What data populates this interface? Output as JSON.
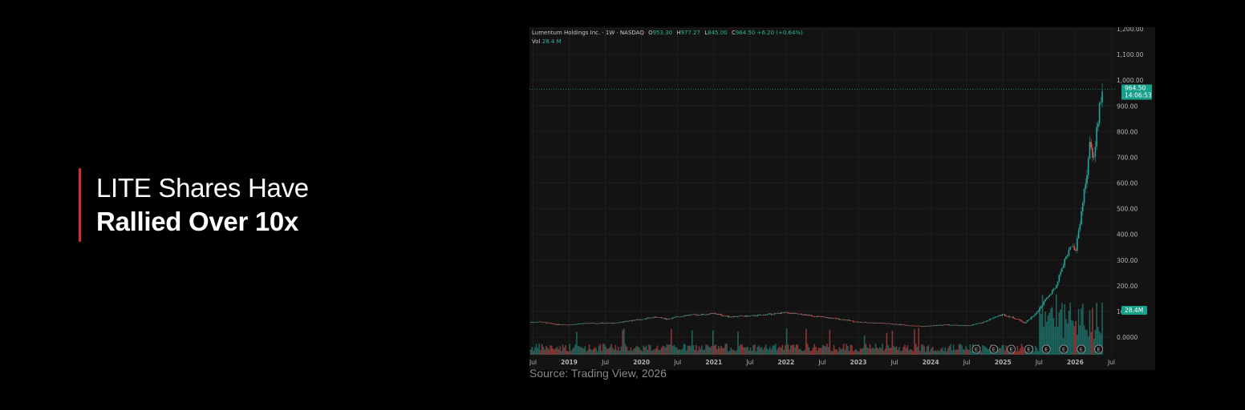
{
  "headline": {
    "line1": "LITE Shares Have",
    "line2": "Rallied Over 10x",
    "accent_color": "#d32f2f"
  },
  "source": "Source: Trading View, 2026",
  "chart_data": {
    "type": "candlestick",
    "symbol_line": "Lumentum Holdings Inc. · 1W · NASDAQ",
    "ohlc": {
      "open_label": "O",
      "open": "953.30",
      "high_label": "H",
      "high": "977.27",
      "low_label": "L",
      "low": "845.00",
      "close_label": "C",
      "close": "964.50",
      "change": "+6.20 (+0.64%)"
    },
    "volume_label": "Vol",
    "volume_value": "28.4 M",
    "last_price_tag": "964.50",
    "countdown_tag": "14:06:53",
    "volume_tag": "28.4M",
    "y_ticks": [
      "1,200.00",
      "1,100.00",
      "1,000.00",
      "900.00",
      "800.00",
      "700.00",
      "600.00",
      "500.00",
      "400.00",
      "300.00",
      "200.00",
      "100.00",
      "0.0000"
    ],
    "y_tick_values": [
      1200,
      1100,
      1000,
      900,
      800,
      700,
      600,
      500,
      400,
      300,
      200,
      100,
      0
    ],
    "ylim": [
      0,
      1200
    ],
    "x_ticks": [
      "Jul",
      "2019",
      "Jul",
      "2020",
      "Jul",
      "2021",
      "Jul",
      "2022",
      "Jul",
      "2023",
      "Jul",
      "2024",
      "Jul",
      "2025",
      "Jul",
      "2026",
      "Jul"
    ],
    "x_tick_years": [
      2018.5,
      2019,
      2019.5,
      2020,
      2020.5,
      2021,
      2021.5,
      2022,
      2022.5,
      2023,
      2023.5,
      2024,
      2024.5,
      2025,
      2025.5,
      2026,
      2026.5
    ],
    "xlim": [
      2018.45,
      2026.55
    ],
    "price_path": [
      {
        "t": 2018.45,
        "p": 58
      },
      {
        "t": 2018.6,
        "p": 60
      },
      {
        "t": 2018.8,
        "p": 50
      },
      {
        "t": 2019.0,
        "p": 48
      },
      {
        "t": 2019.3,
        "p": 55
      },
      {
        "t": 2019.6,
        "p": 54
      },
      {
        "t": 2019.9,
        "p": 66
      },
      {
        "t": 2020.2,
        "p": 78
      },
      {
        "t": 2020.35,
        "p": 70
      },
      {
        "t": 2020.6,
        "p": 85
      },
      {
        "t": 2020.85,
        "p": 88
      },
      {
        "t": 2021.0,
        "p": 92
      },
      {
        "t": 2021.2,
        "p": 80
      },
      {
        "t": 2021.5,
        "p": 82
      },
      {
        "t": 2021.8,
        "p": 90
      },
      {
        "t": 2022.0,
        "p": 95
      },
      {
        "t": 2022.3,
        "p": 85
      },
      {
        "t": 2022.5,
        "p": 78
      },
      {
        "t": 2022.8,
        "p": 68
      },
      {
        "t": 2023.0,
        "p": 58
      },
      {
        "t": 2023.3,
        "p": 55
      },
      {
        "t": 2023.6,
        "p": 48
      },
      {
        "t": 2023.9,
        "p": 42
      },
      {
        "t": 2024.2,
        "p": 48
      },
      {
        "t": 2024.5,
        "p": 44
      },
      {
        "t": 2024.7,
        "p": 55
      },
      {
        "t": 2024.9,
        "p": 80
      },
      {
        "t": 2025.0,
        "p": 88
      },
      {
        "t": 2025.2,
        "p": 70
      },
      {
        "t": 2025.3,
        "p": 55
      },
      {
        "t": 2025.45,
        "p": 90
      },
      {
        "t": 2025.6,
        "p": 150
      },
      {
        "t": 2025.72,
        "p": 190
      },
      {
        "t": 2025.85,
        "p": 300
      },
      {
        "t": 2025.95,
        "p": 360
      },
      {
        "t": 2026.0,
        "p": 330
      },
      {
        "t": 2026.08,
        "p": 480
      },
      {
        "t": 2026.15,
        "p": 620
      },
      {
        "t": 2026.2,
        "p": 740
      },
      {
        "t": 2026.26,
        "p": 700
      },
      {
        "t": 2026.3,
        "p": 820
      },
      {
        "t": 2026.35,
        "p": 930
      },
      {
        "t": 2026.38,
        "p": 964.5
      }
    ],
    "earnings_marker": "E",
    "earnings_markers_count": 8,
    "colors": {
      "up": "#26a69a",
      "down": "#ef5350",
      "background": "#131313",
      "grid": "#1e1e1e",
      "axis_text": "#b2b2b2",
      "tag_bg": "#17a08a"
    },
    "grid": true
  }
}
